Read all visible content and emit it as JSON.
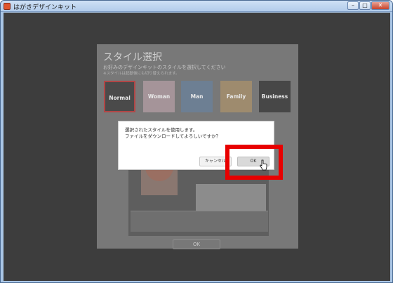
{
  "window": {
    "title": "はがきデザインキット",
    "minimize": "–",
    "maximize": "□",
    "close": "✕"
  },
  "panel": {
    "title": "スタイル選択",
    "subtitle": "お好みのデザインキットのスタイルを選択してください",
    "note": "※スタイルは起動後にも切り替えられます。",
    "styles": [
      "Normal",
      "Woman",
      "Man",
      "Family",
      "Business"
    ],
    "ok_label": "OK"
  },
  "dialog": {
    "line1": "選択されたスタイルを使用します。",
    "line2": "ファイルをダウンロードしてよろしいですか？",
    "cancel_label": "キャンセル",
    "ok_label": "OK"
  },
  "colors": {
    "highlight": "#e80000",
    "overlay": "#3d3d3d"
  },
  "icons": {
    "cursor": "pointer-hand-icon",
    "app": "app-icon"
  }
}
